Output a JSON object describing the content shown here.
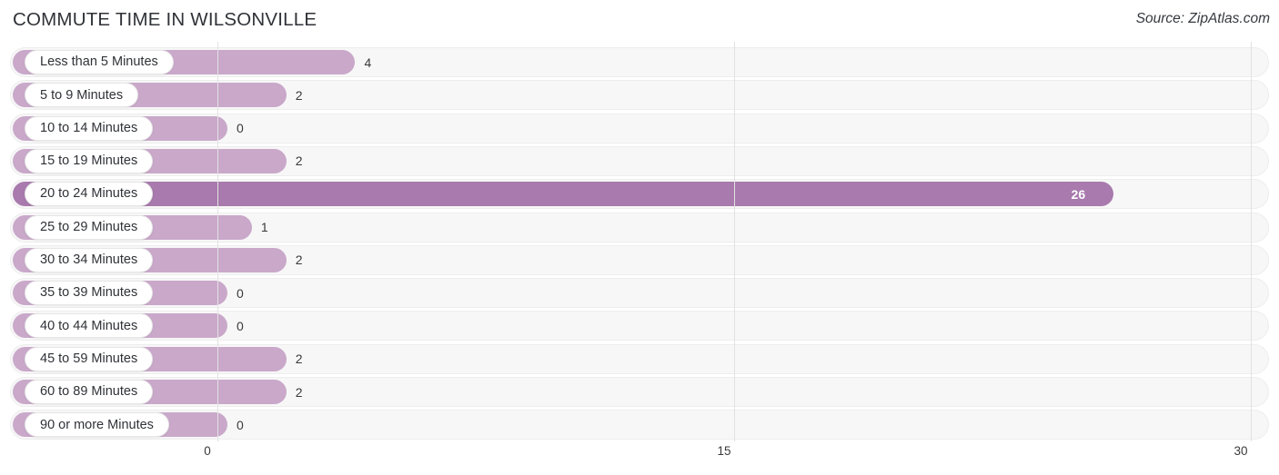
{
  "header": {
    "title": "COMMUTE TIME IN WILSONVILLE",
    "source": "Source: ZipAtlas.com"
  },
  "colors": {
    "bar": "#c9a8ca",
    "bar_highlight": "#a87aad",
    "track": "#f7f7f7",
    "track_border": "#ededed",
    "gridline": "#e2e2e2",
    "text": "#3a3a3a",
    "value_in_bar_text": "#ffffff"
  },
  "chart_data": {
    "type": "bar",
    "orientation": "horizontal",
    "title": "COMMUTE TIME IN WILSONVILLE",
    "xlabel": "",
    "ylabel": "",
    "xlim": [
      0,
      30
    ],
    "xticks": [
      0,
      15,
      30
    ],
    "xtick_labels": [
      "0",
      "15",
      "30"
    ],
    "grid": true,
    "legend": false,
    "max_value_highlighted": 26,
    "categories": [
      "Less than 5 Minutes",
      "5 to 9 Minutes",
      "10 to 14 Minutes",
      "15 to 19 Minutes",
      "20 to 24 Minutes",
      "25 to 29 Minutes",
      "30 to 34 Minutes",
      "35 to 39 Minutes",
      "40 to 44 Minutes",
      "45 to 59 Minutes",
      "60 to 89 Minutes",
      "90 or more Minutes"
    ],
    "values": [
      4,
      2,
      0,
      2,
      26,
      1,
      2,
      0,
      0,
      2,
      2,
      0
    ],
    "value_labels": [
      "4",
      "2",
      "0",
      "2",
      "26",
      "1",
      "2",
      "0",
      "0",
      "2",
      "2",
      "0"
    ]
  }
}
